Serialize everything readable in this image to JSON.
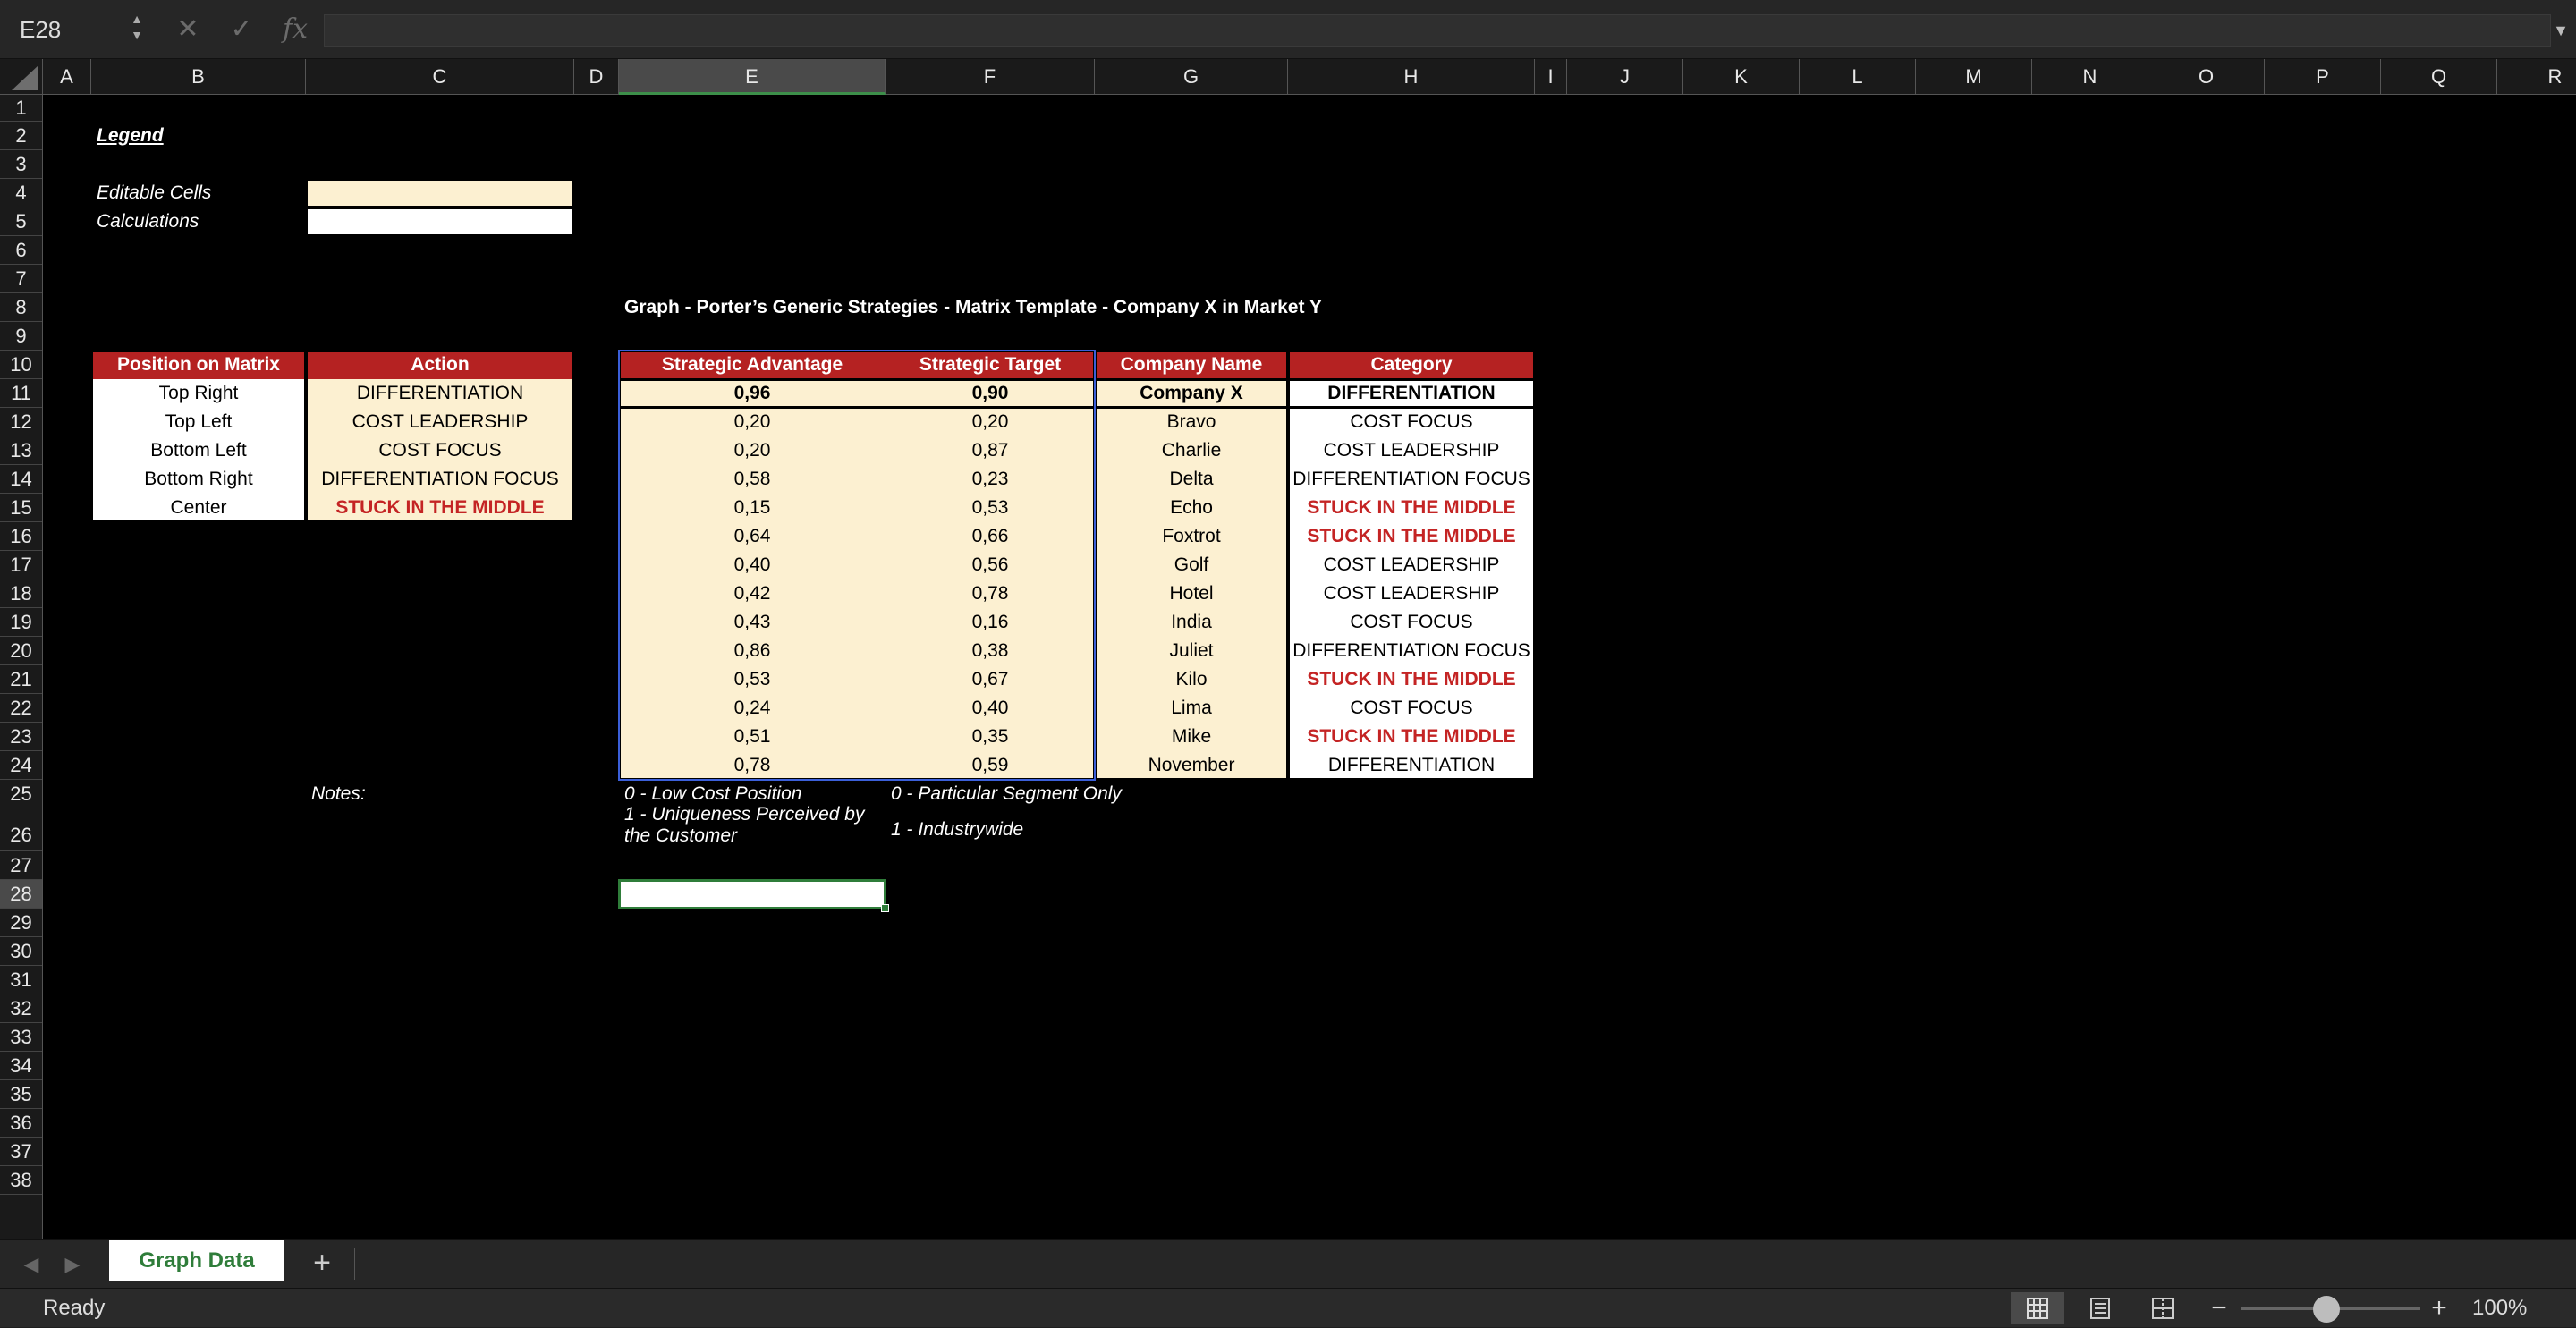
{
  "formula_bar": {
    "name_box": "E28",
    "cancel_glyph": "✕",
    "enter_glyph": "✓",
    "fx_label": "fx",
    "formula": ""
  },
  "columns": [
    "A",
    "B",
    "C",
    "D",
    "E",
    "F",
    "G",
    "H",
    "I",
    "J",
    "K",
    "L",
    "M",
    "N",
    "O",
    "P",
    "Q",
    "R"
  ],
  "rows": [
    "1",
    "2",
    "3",
    "4",
    "5",
    "6",
    "7",
    "8",
    "9",
    "10",
    "11",
    "12",
    "13",
    "14",
    "15",
    "16",
    "17",
    "18",
    "19",
    "20",
    "21",
    "22",
    "23",
    "24",
    "25",
    "26",
    "27",
    "28",
    "29",
    "30",
    "31",
    "32",
    "33",
    "34",
    "35",
    "36",
    "37",
    "38"
  ],
  "selected_cell": {
    "column": "E",
    "row": "28"
  },
  "legend": {
    "title": "Legend",
    "editable_label": "Editable Cells",
    "calculations_label": "Calculations"
  },
  "graph_title": "Graph - Porter’s Generic Strategies - Matrix Template - Company X in Market Y",
  "matrix_table": {
    "headers": [
      "Position on Matrix",
      "Action"
    ],
    "rows": [
      {
        "position": "Top Right",
        "action": "DIFFERENTIATION"
      },
      {
        "position": "Top Left",
        "action": "COST LEADERSHIP"
      },
      {
        "position": "Bottom Left",
        "action": "COST FOCUS"
      },
      {
        "position": "Bottom Right",
        "action": "DIFFERENTIATION FOCUS"
      },
      {
        "position": "Center",
        "action": "STUCK IN THE MIDDLE"
      }
    ]
  },
  "data_table": {
    "headers": [
      "Strategic Advantage",
      "Strategic Target",
      "Company Name",
      "Category"
    ],
    "rows": [
      {
        "advantage": "0,96",
        "target": "0,90",
        "company": "Company X",
        "category": "DIFFERENTIATION"
      },
      {
        "advantage": "0,20",
        "target": "0,20",
        "company": "Bravo",
        "category": "COST FOCUS"
      },
      {
        "advantage": "0,20",
        "target": "0,87",
        "company": "Charlie",
        "category": "COST LEADERSHIP"
      },
      {
        "advantage": "0,58",
        "target": "0,23",
        "company": "Delta",
        "category": "DIFFERENTIATION FOCUS"
      },
      {
        "advantage": "0,15",
        "target": "0,53",
        "company": "Echo",
        "category": "STUCK IN THE MIDDLE"
      },
      {
        "advantage": "0,64",
        "target": "0,66",
        "company": "Foxtrot",
        "category": "STUCK IN THE MIDDLE"
      },
      {
        "advantage": "0,40",
        "target": "0,56",
        "company": "Golf",
        "category": "COST LEADERSHIP"
      },
      {
        "advantage": "0,42",
        "target": "0,78",
        "company": "Hotel",
        "category": "COST LEADERSHIP"
      },
      {
        "advantage": "0,43",
        "target": "0,16",
        "company": "India",
        "category": "COST FOCUS"
      },
      {
        "advantage": "0,86",
        "target": "0,38",
        "company": "Juliet",
        "category": "DIFFERENTIATION FOCUS"
      },
      {
        "advantage": "0,53",
        "target": "0,67",
        "company": "Kilo",
        "category": "STUCK IN THE MIDDLE"
      },
      {
        "advantage": "0,24",
        "target": "0,40",
        "company": "Lima",
        "category": "COST FOCUS"
      },
      {
        "advantage": "0,51",
        "target": "0,35",
        "company": "Mike",
        "category": "STUCK IN THE MIDDLE"
      },
      {
        "advantage": "0,78",
        "target": "0,59",
        "company": "November",
        "category": "DIFFERENTIATION"
      }
    ]
  },
  "notes": {
    "label": "Notes:",
    "advantage_low": "0 - Low Cost Position",
    "advantage_high": "1 - Uniqueness Perceived by the Customer",
    "target_low": "0 - Particular Segment Only",
    "target_high": "1 -  Industrywide"
  },
  "sheet_tabs": {
    "active": "Graph Data",
    "add_label": "+"
  },
  "status_bar": {
    "status": "Ready",
    "zoom": "100%",
    "zoom_percent": 100
  },
  "colors": {
    "header_red": "#b52222",
    "editable_cream": "#fcf0d1",
    "stuck_red": "#c42424",
    "selection_green": "#2f7d3a"
  }
}
